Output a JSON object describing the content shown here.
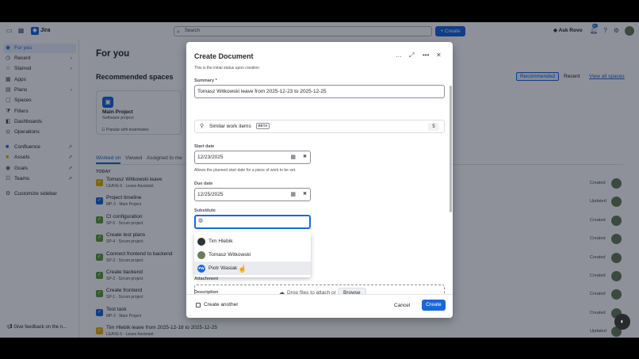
{
  "topbar": {
    "app_name": "Jira",
    "search_placeholder": "Search",
    "create_label": "Create",
    "rovo_label": "Ask Rovo",
    "notif_count": "9+"
  },
  "sidebar": {
    "items": [
      {
        "label": "For you",
        "icon": "user-icon"
      },
      {
        "label": "Recent",
        "icon": "clock-icon"
      },
      {
        "label": "Starred",
        "icon": "star-icon"
      },
      {
        "label": "Apps",
        "icon": "apps-icon"
      },
      {
        "label": "Plans",
        "icon": "plans-icon"
      },
      {
        "label": "Spaces",
        "icon": "spaces-icon"
      },
      {
        "label": "Filters",
        "icon": "filter-icon"
      },
      {
        "label": "Dashboards",
        "icon": "dashboard-icon"
      },
      {
        "label": "Operations",
        "icon": "operations-icon"
      },
      {
        "label": "Confluence",
        "icon": "confluence-icon"
      },
      {
        "label": "Assets",
        "icon": "assets-icon"
      },
      {
        "label": "Goals",
        "icon": "goals-icon"
      },
      {
        "label": "Teams",
        "icon": "teams-icon"
      },
      {
        "label": "Customize sidebar",
        "icon": "customize-icon"
      }
    ],
    "feedback": "Give feedback on the n..."
  },
  "main": {
    "title": "For you",
    "recommended_title": "Recommended spaces",
    "card": {
      "name": "Main Project",
      "sub": "Software project",
      "popular": "Popular with teammates"
    },
    "tab_recommended": "Recommended",
    "tab_recent": "Recent",
    "view_all": "View all spaces",
    "work_tabs": [
      "Worked on",
      "Viewed",
      "Assigned to me"
    ],
    "today": "TODAY",
    "rows": [
      {
        "title": "Tomasz Witkowski leave",
        "sub": "LEAVE-6 · Leave Assistant",
        "status": "Created",
        "color": "#e2b203",
        "icon": "leave-icon"
      },
      {
        "title": "Project timeline",
        "sub": "MP-3 · Main Project",
        "status": "Updated",
        "color": "#1868db",
        "icon": "task-icon"
      },
      {
        "title": "CI configuration",
        "sub": "SP-5 · Scrum project",
        "status": "Created",
        "color": "#5b9e3a",
        "icon": "story-icon"
      },
      {
        "title": "Create test plans",
        "sub": "SP-4 · Scrum project",
        "status": "Created",
        "color": "#5b9e3a",
        "icon": "story-icon"
      },
      {
        "title": "Connect frontend to backend",
        "sub": "SP-3 · Scrum project",
        "status": "Created",
        "color": "#5b9e3a",
        "icon": "story-icon"
      },
      {
        "title": "Create backend",
        "sub": "SP-2 · Scrum project",
        "status": "Created",
        "color": "#5b9e3a",
        "icon": "story-icon"
      },
      {
        "title": "Create frontend",
        "sub": "SP-1 · Scrum project",
        "status": "Created",
        "color": "#5b9e3a",
        "icon": "story-icon"
      },
      {
        "title": "Test task",
        "sub": "MP-2 · Main Project",
        "status": "Created",
        "color": "#1868db",
        "icon": "task-icon"
      },
      {
        "title": "Tim Hlebik leave from 2025-12-18 to 2025-12-25",
        "sub": "LEAVE-5 · Leave Assistant",
        "status": "Updated",
        "color": "#e2b203",
        "icon": "leave-icon"
      }
    ]
  },
  "modal": {
    "title": "Create Document",
    "status_help": "This is the initial status upon creation",
    "summary_label": "Summary",
    "summary_required": "*",
    "summary_value": "Tomasz Witkowski leave from 2025-12-23 to 2025-12-25",
    "similar_label": "Similar work items",
    "beta": "BETA",
    "similar_count": "5",
    "start_label": "Start date",
    "start_value": "12/23/2025",
    "start_help": "Allows the planned start date for a piece of work to be set.",
    "due_label": "Due date",
    "due_value": "12/25/2025",
    "substitute_label": "Substitute",
    "options": [
      {
        "name": "Tim Hlebik",
        "initials": "",
        "color": "#2f3337"
      },
      {
        "name": "Tomasz Witkowski",
        "initials": "",
        "color": "#6b7d5a"
      },
      {
        "name": "Piotr Wasiak",
        "initials": "PW",
        "color": "#1868db"
      }
    ],
    "attachment_label": "Attachment",
    "drop_text": "Drop files to attach or",
    "browse": "Browse",
    "description_label": "Description",
    "create_another": "Create another",
    "cancel": "Cancel",
    "create": "Create"
  }
}
